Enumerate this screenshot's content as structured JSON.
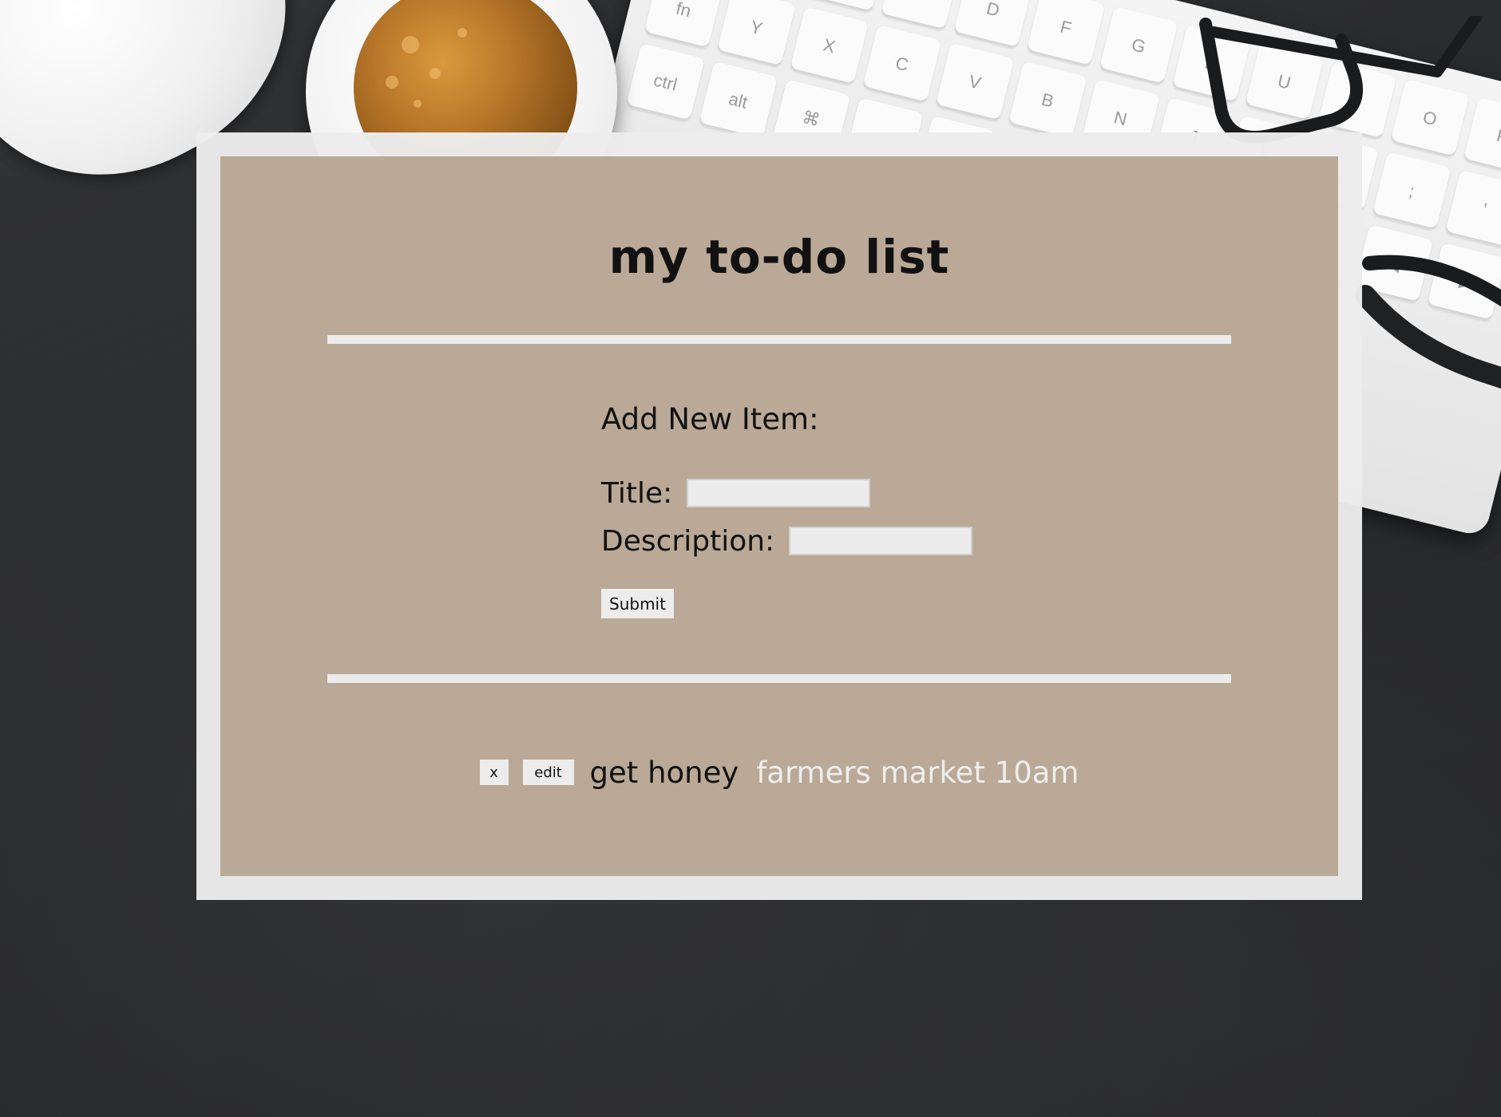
{
  "app": {
    "title": "my to-do list"
  },
  "form": {
    "heading": "Add New Item:",
    "title_label": "Title:",
    "title_value": "",
    "description_label": "Description:",
    "description_value": "",
    "submit_label": "Submit"
  },
  "todos": [
    {
      "delete_label": "x",
      "edit_label": "edit",
      "title": "get honey",
      "description": "farmers market 10am"
    }
  ],
  "colors": {
    "panel": "#b7a591",
    "frame": "#ececec",
    "divider": "#ececec",
    "title_text": "#111111",
    "description_text": "#eeeeee"
  },
  "icons": {
    "decorative": [
      "coffee-cup-icon",
      "computer-mouse-icon",
      "keyboard-icon",
      "eyeglasses-icon",
      "pen-icon"
    ]
  }
}
